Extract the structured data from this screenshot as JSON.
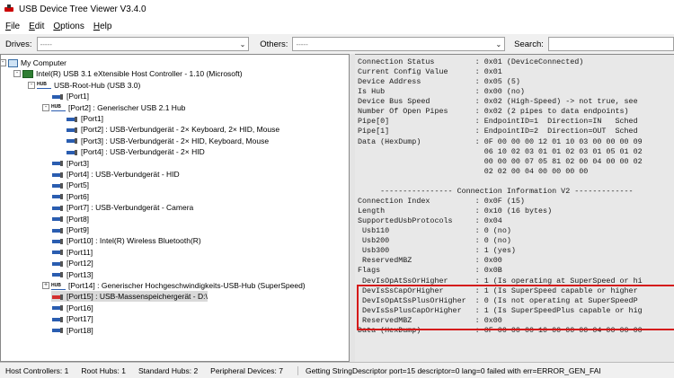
{
  "window": {
    "title": "USB Device Tree Viewer V3.4.0"
  },
  "menu": [
    {
      "label": "File"
    },
    {
      "label": "Edit"
    },
    {
      "label": "Options"
    },
    {
      "label": "Help"
    }
  ],
  "toolbar": {
    "drives_label": "Drives:",
    "drives_value": "-----",
    "others_label": "Others:",
    "others_value": "-----",
    "search_label": "Search:",
    "search_value": ""
  },
  "tree": [
    {
      "label": "My Computer",
      "icon": "computer-icon",
      "expander": "-"
    },
    {
      "label": "Intel(R) USB 3.1 eXtensible Host Controller - 1.10 (Microsoft)",
      "icon": "host-controller-icon",
      "expander": "-"
    },
    {
      "label": "USB-Root-Hub (USB 3.0)",
      "icon": "hub-icon",
      "expander": "-"
    },
    {
      "label": "[Port1]",
      "icon": "port-icon"
    },
    {
      "label": "[Port2] : Generischer USB 2.1 Hub",
      "icon": "hub-icon",
      "expander": "-"
    },
    {
      "label": "[Port1]",
      "icon": "port-icon"
    },
    {
      "label": "[Port2] : USB-Verbundgerät - 2× Keyboard, 2× HID, Mouse",
      "icon": "port-icon"
    },
    {
      "label": "[Port3] : USB-Verbundgerät - 2× HID, Keyboard, Mouse",
      "icon": "port-icon"
    },
    {
      "label": "[Port4] : USB-Verbundgerät - 2× HID",
      "icon": "port-icon"
    },
    {
      "label": "[Port3]",
      "icon": "port-icon"
    },
    {
      "label": "[Port4] : USB-Verbundgerät - HID",
      "icon": "port-icon"
    },
    {
      "label": "[Port5]",
      "icon": "port-icon"
    },
    {
      "label": "[Port6]",
      "icon": "port-icon"
    },
    {
      "label": "[Port7] : USB-Verbundgerät - Camera",
      "icon": "port-icon"
    },
    {
      "label": "[Port8]",
      "icon": "port-icon"
    },
    {
      "label": "[Port9]",
      "icon": "port-icon"
    },
    {
      "label": "[Port10] : Intel(R) Wireless Bluetooth(R)",
      "icon": "port-icon"
    },
    {
      "label": "[Port11]",
      "icon": "port-icon"
    },
    {
      "label": "[Port12]",
      "icon": "port-icon"
    },
    {
      "label": "[Port13]",
      "icon": "port-icon"
    },
    {
      "label": "[Port14] : Generischer Hochgeschwindigkeits-USB-Hub (SuperSpeed)",
      "icon": "hub-icon",
      "expander": "+"
    },
    {
      "label": "[Port15] : USB-Massenspeichergerät - D:\\",
      "icon": "port-icon",
      "selected": true
    },
    {
      "label": "[Port16]",
      "icon": "port-icon"
    },
    {
      "label": "[Port17]",
      "icon": "port-icon"
    },
    {
      "label": "[Port18]",
      "icon": "port-icon"
    }
  ],
  "hub_icon_text": "HUB",
  "details": [
    "Connection Status         : 0x01 (DeviceConnected)",
    "Current Config Value      : 0x01",
    "Device Address            : 0x05 (5)",
    "Is Hub                    : 0x00 (no)",
    "Device Bus Speed          : 0x02 (High-Speed) -> not true, see",
    "Number Of Open Pipes      : 0x02 (2 pipes to data endpoints)",
    "Pipe[0]                   : EndpointID=1  Direction=IN   Sched",
    "Pipe[1]                   : EndpointID=2  Direction=OUT  Sched",
    "Data (HexDump)            : 0F 00 00 00 12 01 10 03 00 00 00 09",
    "                            06 10 02 03 01 01 02 03 01 05 01 02",
    "                            00 00 00 07 05 81 02 00 04 00 00 02",
    "                            02 02 00 04 00 00 00 00",
    "",
    "     ---------------- Connection Information V2 -------------",
    "Connection Index          : 0x0F (15)",
    "Length                    : 0x10 (16 bytes)",
    "SupportedUsbProtocols     : 0x04",
    " Usb110                   : 0 (no)",
    " Usb200                   : 0 (no)",
    " Usb300                   : 1 (yes)",
    " ReservedMBZ              : 0x00",
    "Flags                     : 0x0B",
    " DevIsOpAtSsOrHigher      : 1 (Is operating at SuperSpeed or hi",
    " DevIsSsCapOrHigher       : 1 (Is SuperSpeed capable or higher",
    " DevIsOpAtSsPlusOrHigher  : 0 (Is not operating at SuperSpeedP",
    " DevIsSsPlusCapOrHigher   : 1 (Is SuperSpeedPlus capable or hig",
    " ReservedMBZ              : 0x00",
    "Data (HexDump)            : 0F 00 00 00 10 00 00 00 04 00 00 00"
  ],
  "status": {
    "host_controllers": "Host Controllers: 1",
    "root_hubs": "Root Hubs: 1",
    "standard_hubs": "Standard Hubs: 2",
    "peripheral_devices": "Peripheral Devices: 7",
    "message": "Getting StringDescriptor port=15 descriptor=0 lang=0 failed with err=ERROR_GEN_FAI"
  },
  "colors": {
    "highlight": "#d51a1a",
    "selection": "#d9d9d9"
  }
}
